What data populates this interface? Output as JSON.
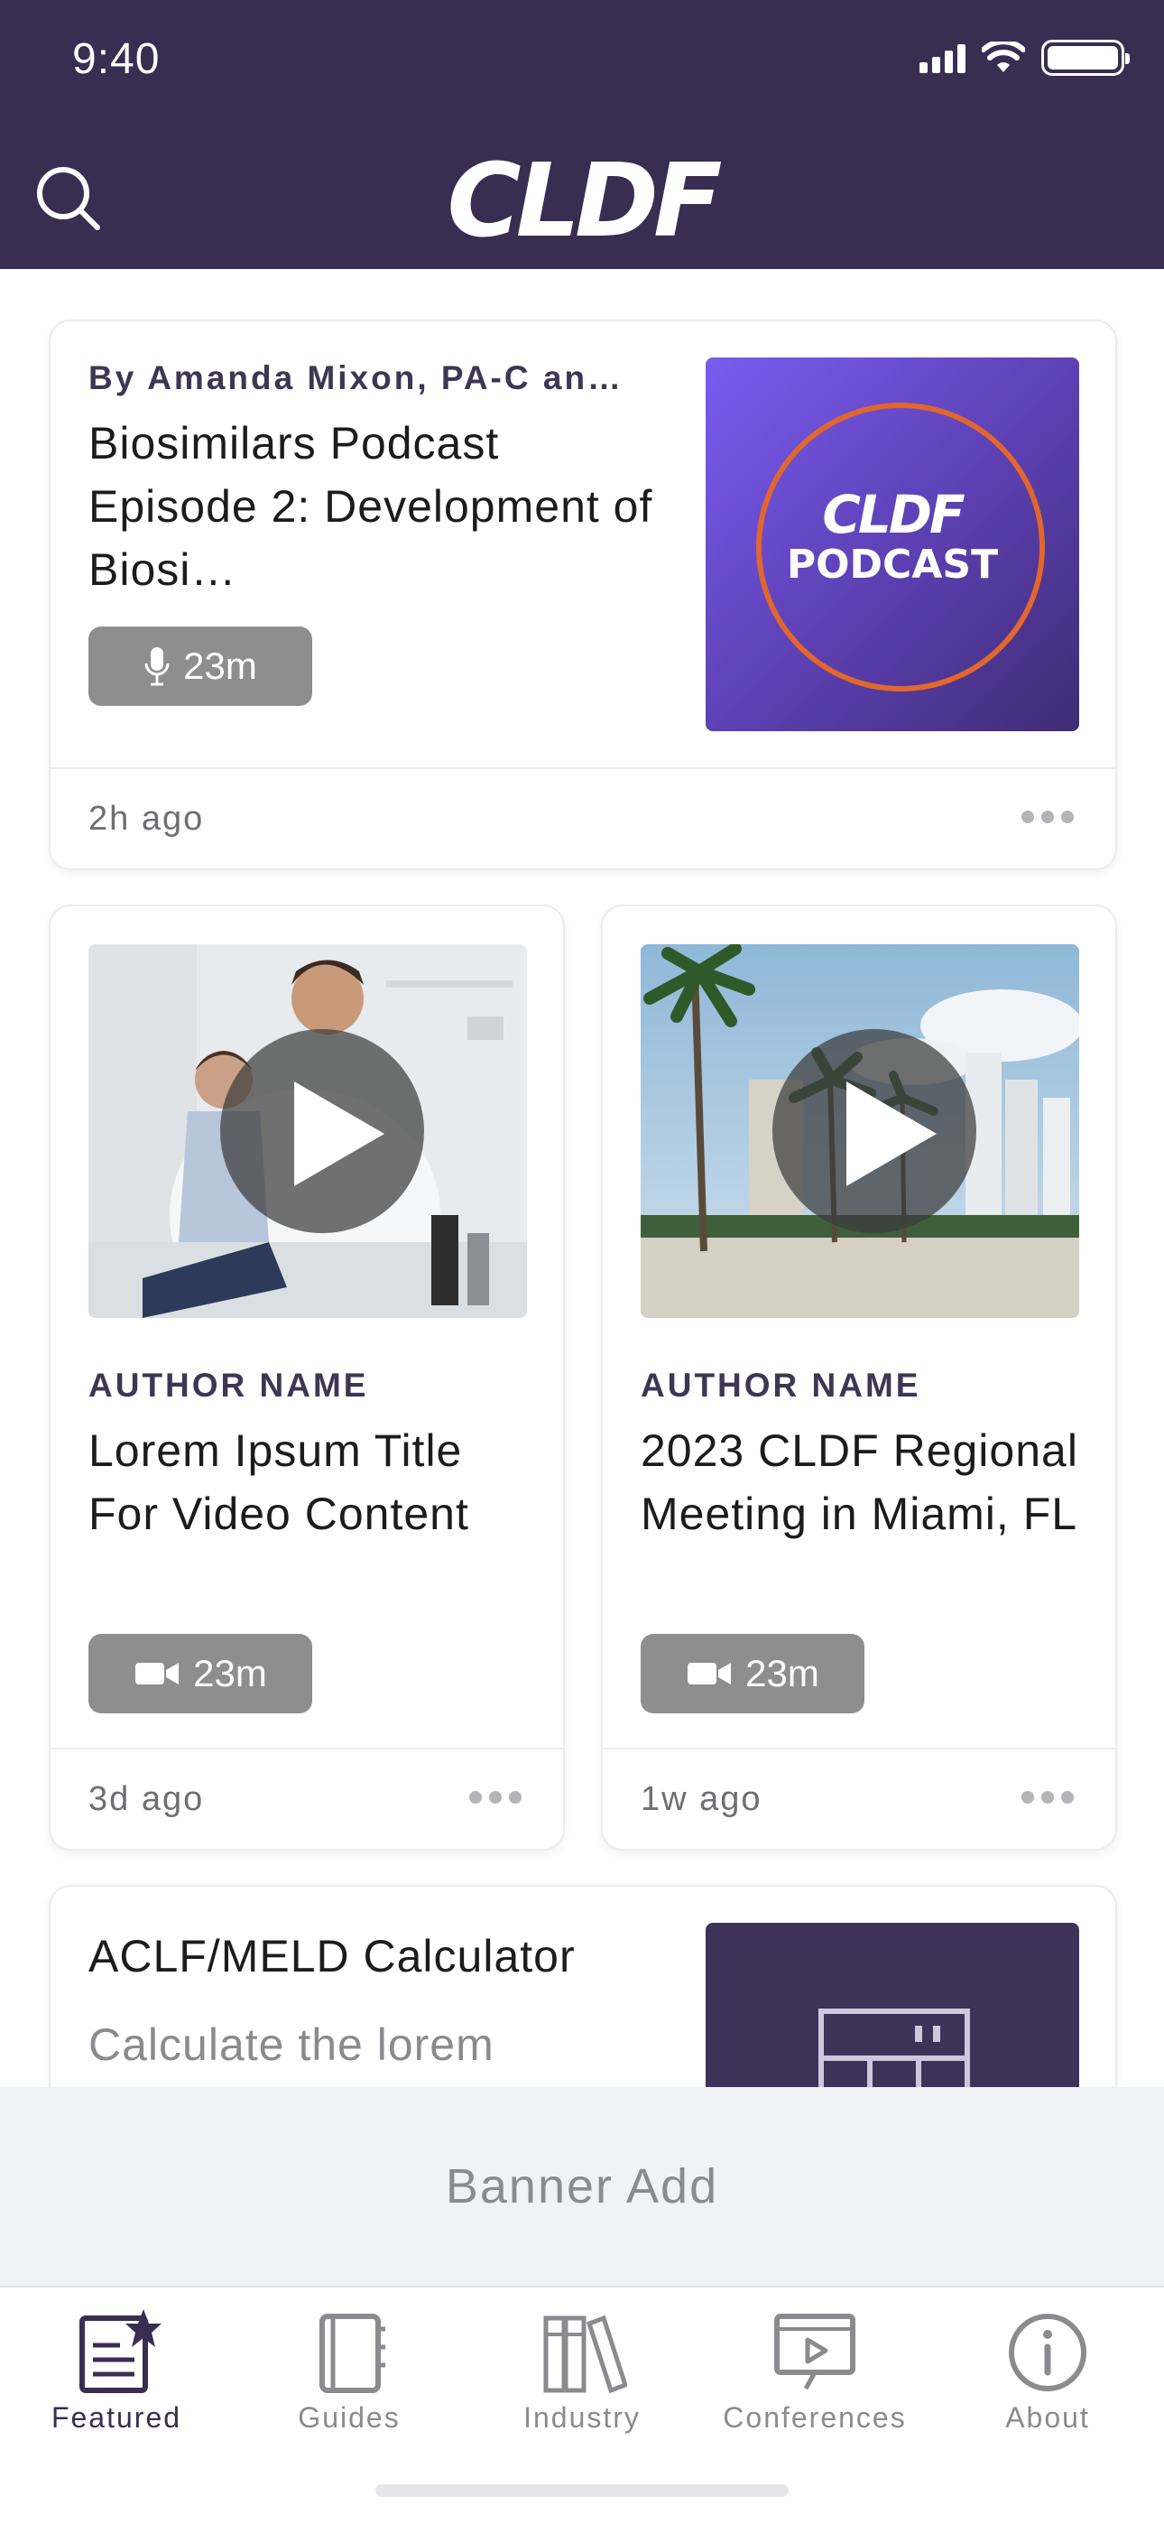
{
  "status_bar": {
    "time": "9:40"
  },
  "header": {
    "logo_text": "CLDF",
    "brand_color": "#3a2d52",
    "search_icon": "search-icon"
  },
  "feed": {
    "podcast_card": {
      "author": "By Amanda Mixon, PA-C an…",
      "title": "Biosimilars Podcast Episode 2: Development of Biosi…",
      "duration": "23m",
      "media_icon": "microphone-icon",
      "thumbnail": {
        "line1": "CLDF",
        "line2": "PODCAST",
        "ring_color": "#e2672d"
      },
      "time_ago": "2h ago"
    },
    "video_cards": [
      {
        "author": "AUTHOR NAME",
        "title": "Lorem Ipsum Title For Video Content",
        "duration": "23m",
        "media_icon": "video-camera-icon",
        "time_ago": "3d ago"
      },
      {
        "author": "AUTHOR NAME",
        "title": "2023 CLDF Regional Meeting in Miami, FL",
        "duration": "23m",
        "media_icon": "video-camera-icon",
        "time_ago": "1w ago"
      }
    ],
    "tool_card": {
      "title": "ACLF/MELD Calculator",
      "description": "Calculate the lorem",
      "icon": "calculator-icon"
    }
  },
  "banner": {
    "text": "Banner Add"
  },
  "tab_bar": {
    "items": [
      {
        "label": "Featured",
        "icon": "featured-icon",
        "active": true
      },
      {
        "label": "Guides",
        "icon": "book-icon",
        "active": false
      },
      {
        "label": "Industry",
        "icon": "library-icon",
        "active": false
      },
      {
        "label": "Conferences",
        "icon": "presentation-icon",
        "active": false
      },
      {
        "label": "About",
        "icon": "info-icon",
        "active": false
      }
    ]
  }
}
